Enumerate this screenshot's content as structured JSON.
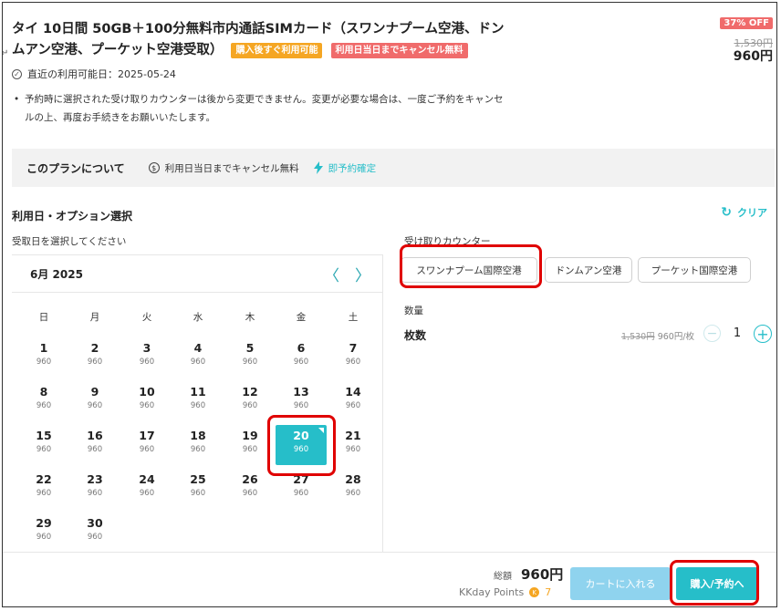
{
  "product": {
    "title": "タイ 10日間 50GB＋100分無料市内通話SIMカード（スワンナプーム空港、ドンムアン空港、プーケット空港受取）",
    "tag_instant": "購入後すぐ利用可能",
    "tag_cancel": "利用日当日までキャンセル無料",
    "discount": "37% OFF",
    "old_price": "1,530円",
    "price": "960円",
    "available_date": "直近の利用可能日：2025-05-24",
    "notice": "予約時に選択された受け取りカウンターは後から変更できません。変更が必要な場合は、一度ご予約をキャンセルの上、再度お手続きをお願いいたします。"
  },
  "plan": {
    "title": "このプランについて",
    "cancel": "利用日当日までキャンセル無料",
    "instant": "即予約確定"
  },
  "options": {
    "section_title": "利用日・オプション選択",
    "clear": "クリア",
    "receive_date_label": "受取日を選択してください"
  },
  "calendar": {
    "month": "6月 2025",
    "weekdays": [
      "日",
      "月",
      "火",
      "水",
      "木",
      "金",
      "土"
    ],
    "selected_day": "20",
    "days": [
      {
        "d": "1",
        "p": "960"
      },
      {
        "d": "2",
        "p": "960"
      },
      {
        "d": "3",
        "p": "960"
      },
      {
        "d": "4",
        "p": "960"
      },
      {
        "d": "5",
        "p": "960"
      },
      {
        "d": "6",
        "p": "960"
      },
      {
        "d": "7",
        "p": "960"
      },
      {
        "d": "8",
        "p": "960"
      },
      {
        "d": "9",
        "p": "960"
      },
      {
        "d": "10",
        "p": "960"
      },
      {
        "d": "11",
        "p": "960"
      },
      {
        "d": "12",
        "p": "960"
      },
      {
        "d": "13",
        "p": "960"
      },
      {
        "d": "14",
        "p": "960"
      },
      {
        "d": "15",
        "p": "960"
      },
      {
        "d": "16",
        "p": "960"
      },
      {
        "d": "17",
        "p": "960"
      },
      {
        "d": "18",
        "p": "960"
      },
      {
        "d": "19",
        "p": "960"
      },
      {
        "d": "20",
        "p": "960"
      },
      {
        "d": "21",
        "p": "960"
      },
      {
        "d": "22",
        "p": "960"
      },
      {
        "d": "23",
        "p": "960"
      },
      {
        "d": "24",
        "p": "960"
      },
      {
        "d": "25",
        "p": "960"
      },
      {
        "d": "26",
        "p": "960"
      },
      {
        "d": "27",
        "p": "960"
      },
      {
        "d": "28",
        "p": "960"
      },
      {
        "d": "29",
        "p": "960"
      },
      {
        "d": "30",
        "p": "960"
      }
    ]
  },
  "counter": {
    "label": "受け取りカウンター",
    "options": [
      "スワンナプーム国際空港",
      "ドンムアン空港",
      "プーケット国際空港"
    ],
    "selected": "スワンナプーム国際空港"
  },
  "quantity": {
    "label": "数量",
    "item": "枚数",
    "old_price": "1,530円",
    "unit_price": "960円/枚",
    "value": "1"
  },
  "footer": {
    "total_label": "総額",
    "total": "960円",
    "points_label": "KKday Points",
    "points": "7",
    "cart_button": "カートに入れる",
    "buy_button": "購入/予約へ"
  },
  "colors": {
    "accent": "#26bec9",
    "tag_orange": "#f5a623",
    "tag_red": "#f06b6b",
    "highlight": "#e00000"
  }
}
